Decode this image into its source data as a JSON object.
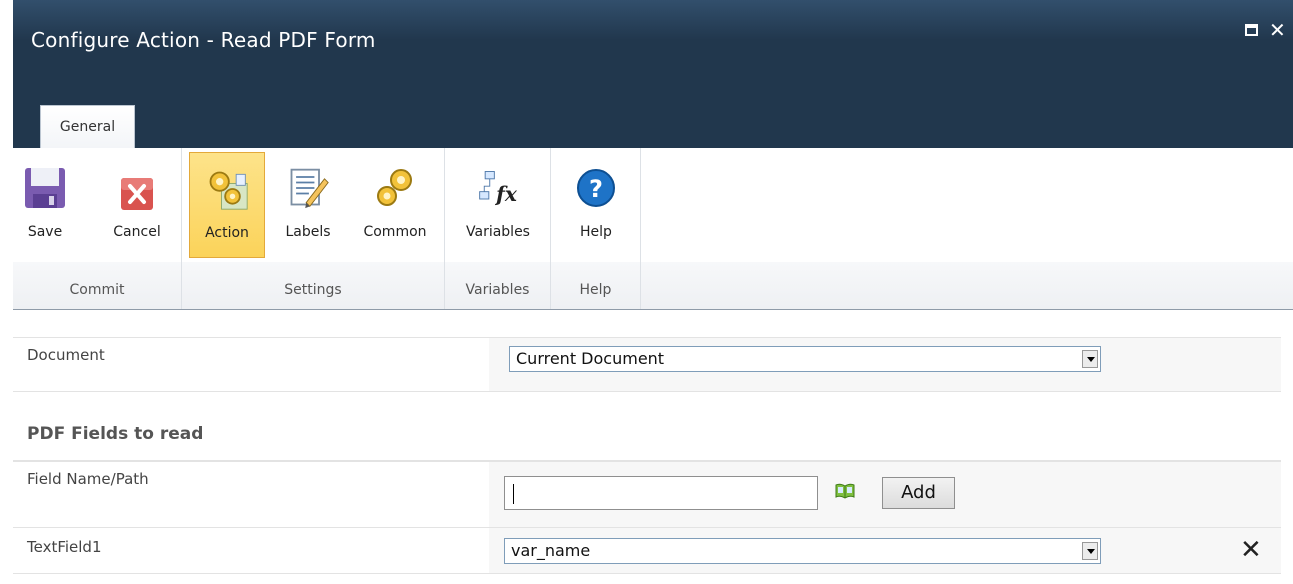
{
  "window": {
    "title": "Configure Action - Read PDF Form",
    "maximize_icon": "maximize-icon",
    "close_icon": "close-icon"
  },
  "tabs": [
    {
      "label": "General"
    }
  ],
  "ribbon": {
    "groups": [
      {
        "label": "Commit",
        "buttons": [
          {
            "label": "Save",
            "icon": "save-icon"
          },
          {
            "label": "Cancel",
            "icon": "cancel-icon"
          }
        ]
      },
      {
        "label": "Settings",
        "buttons": [
          {
            "label": "Action",
            "icon": "action-gears-icon",
            "active": true
          },
          {
            "label": "Labels",
            "icon": "labels-notepad-icon"
          },
          {
            "label": "Common",
            "icon": "common-gears-icon"
          }
        ]
      },
      {
        "label": "Variables",
        "buttons": [
          {
            "label": "Variables",
            "icon": "variables-fx-icon"
          }
        ]
      },
      {
        "label": "Help",
        "buttons": [
          {
            "label": "Help",
            "icon": "help-icon"
          }
        ]
      }
    ]
  },
  "form": {
    "document_label": "Document",
    "document_value": "Current Document",
    "section_title": "PDF Fields to read",
    "field_name_label": "Field Name/Path",
    "field_name_value": "",
    "add_label": "Add",
    "lookup_icon": "lookup-book-icon",
    "rows": [
      {
        "label": "TextField1",
        "value": "var_name",
        "remove_icon": "remove-x-icon"
      }
    ]
  },
  "colors": {
    "titlebar": "#21374d",
    "active_button": "#fbd35a"
  }
}
